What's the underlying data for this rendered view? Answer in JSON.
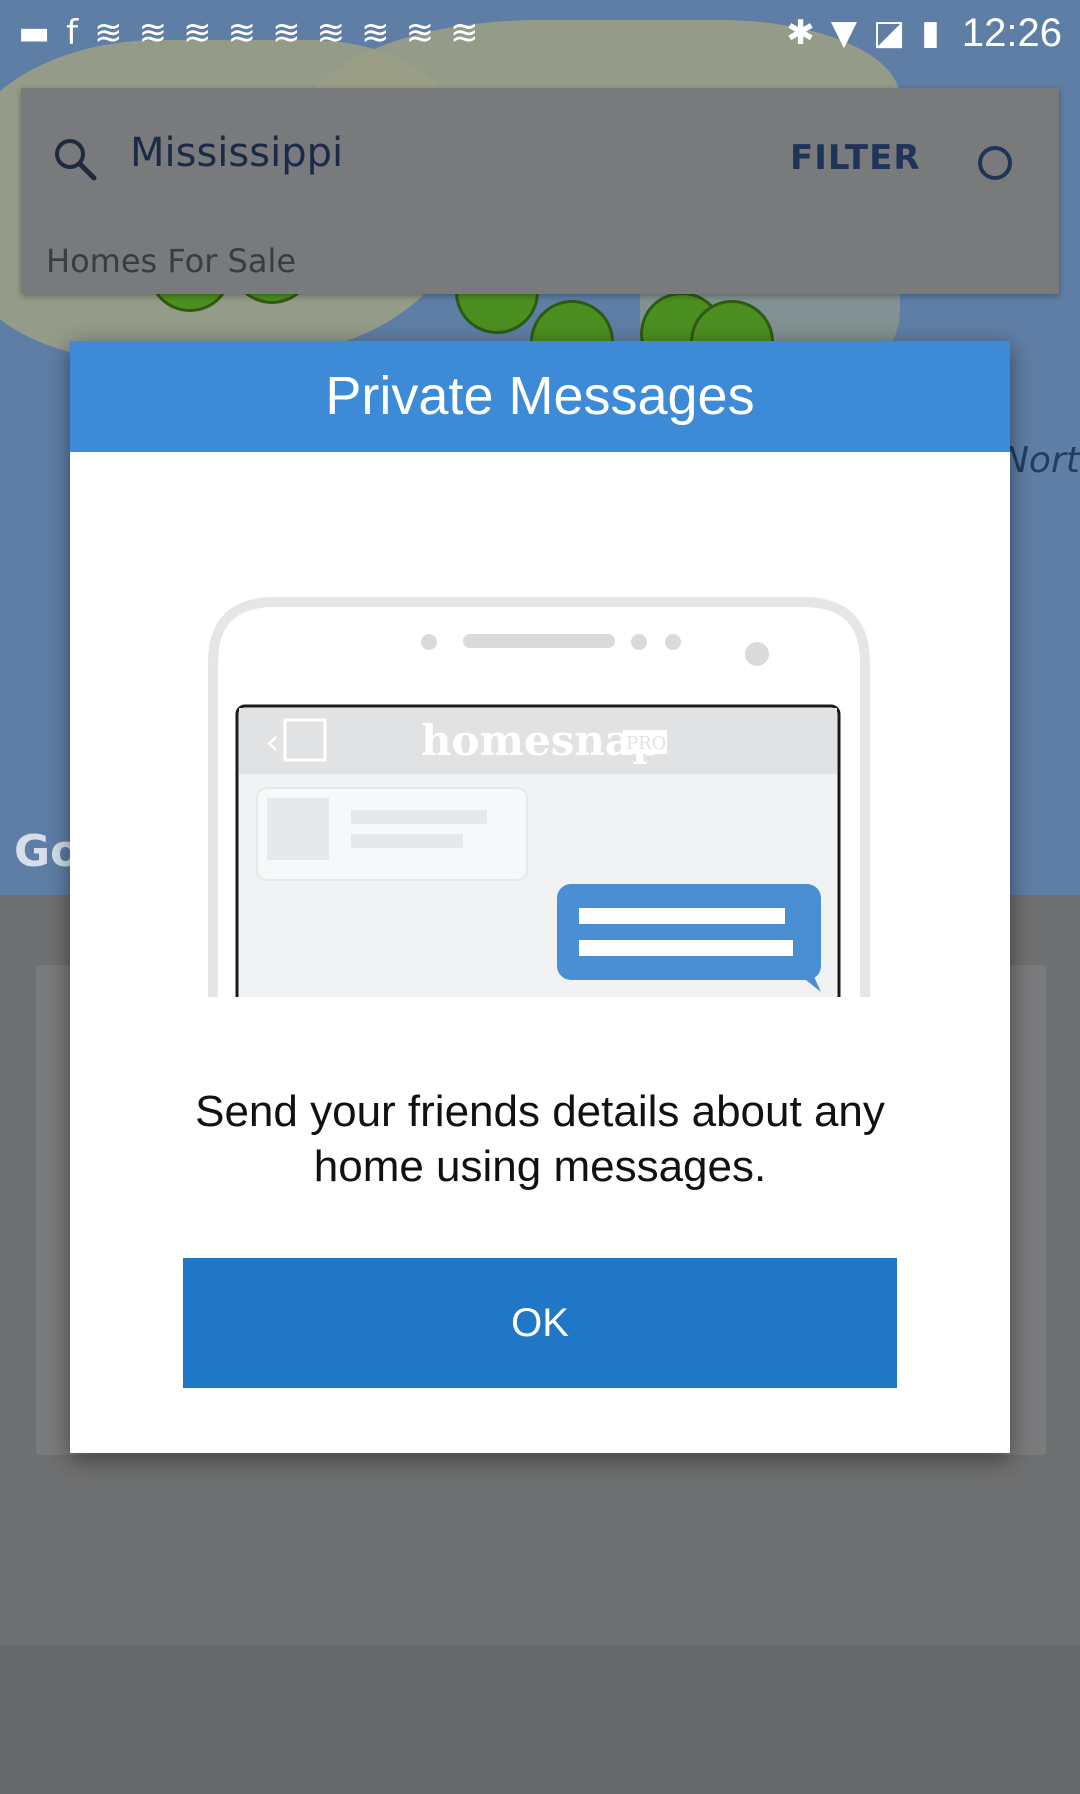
{
  "status_bar": {
    "time": "12:26",
    "notification_icons": [
      "game-controller-icon",
      "facebook-icon",
      "signal-wave-icon",
      "signal-wave-icon",
      "signal-wave-icon",
      "signal-wave-icon",
      "signal-wave-icon",
      "signal-wave-icon",
      "signal-wave-icon",
      "signal-wave-icon",
      "signal-wave-icon"
    ],
    "system_icons": [
      "bluetooth-icon",
      "wifi-icon",
      "no-sim-icon",
      "battery-charging-icon"
    ]
  },
  "search": {
    "query": "Mississippi",
    "filter_label": "FILTER",
    "search_icon": "search-icon",
    "locate_icon": "locate-icon",
    "subheader": "Homes For Sale"
  },
  "map": {
    "ocean_label": "North Atlantic Ocean",
    "attribution": "Go"
  },
  "modal": {
    "title": "Private Messages",
    "illustration_brand": "homesnap",
    "illustration_badge": "PRO",
    "message": "Send your friends details about any home using messages.",
    "ok_label": "OK",
    "header_color": "#3d8bd6",
    "button_color": "#1f77c5"
  }
}
